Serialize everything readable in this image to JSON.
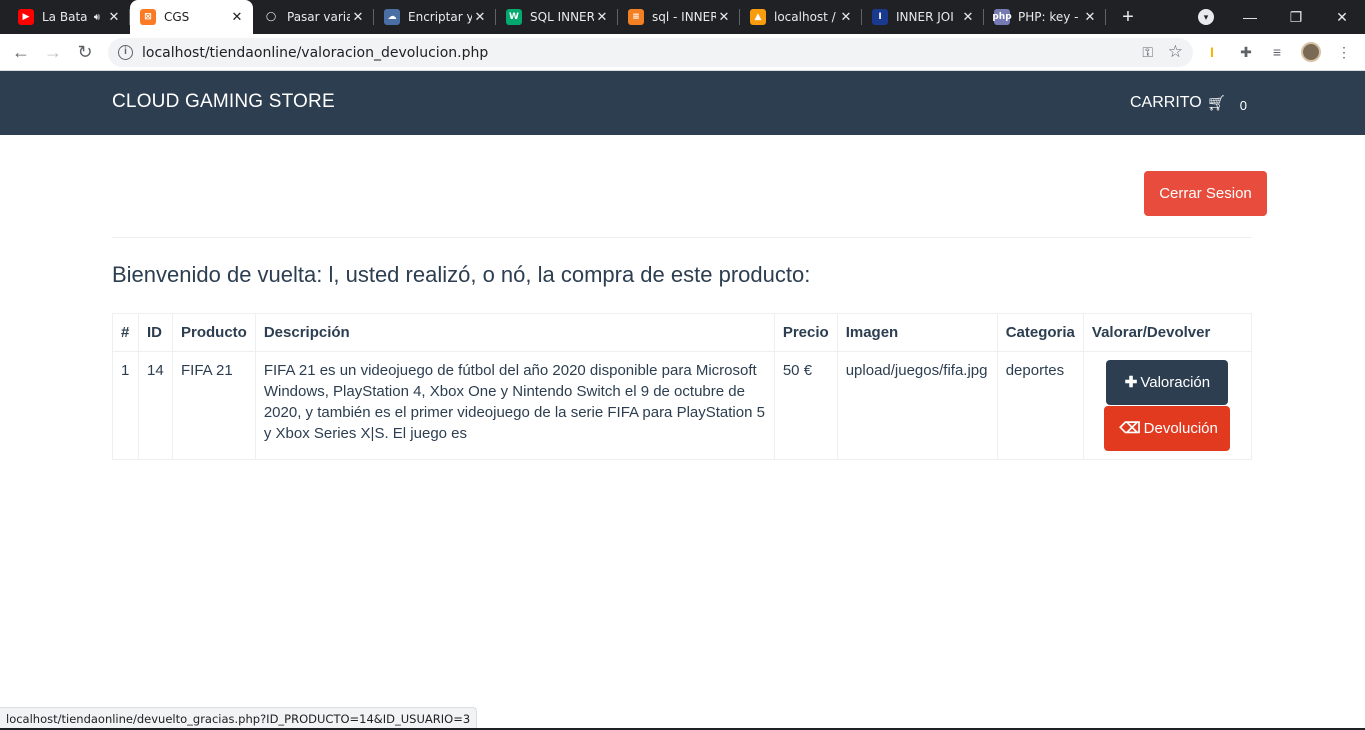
{
  "browser": {
    "tabs": [
      {
        "title": "La Bata",
        "favicon": "youtube-icon",
        "color": "#ff0000",
        "glyph": "▶",
        "audio": true,
        "active": false
      },
      {
        "title": "CGS",
        "favicon": "xampp-icon",
        "color": "#fb7a24",
        "glyph": "⊠",
        "active": true
      },
      {
        "title": "Pasar varia",
        "favicon": "circle-icon",
        "color": "#202124",
        "glyph": "◯",
        "active": false
      },
      {
        "title": "Encriptar y",
        "favicon": "cloud-icon",
        "color": "#4a6fa5",
        "glyph": "☁",
        "active": false
      },
      {
        "title": "SQL INNER",
        "favicon": "w3schools-icon",
        "color": "#04aa6d",
        "glyph": "W",
        "active": false
      },
      {
        "title": "sql - INNER",
        "favicon": "stackoverflow-icon",
        "color": "#f48024",
        "glyph": "≡",
        "active": false
      },
      {
        "title": "localhost /",
        "favicon": "phpmyadmin-icon",
        "color": "#f89c0e",
        "glyph": "▲",
        "active": false
      },
      {
        "title": "INNER JOI",
        "favicon": "doc-icon",
        "color": "#1a3a8f",
        "glyph": "I",
        "active": false
      },
      {
        "title": "PHP: key -",
        "favicon": "php-icon",
        "color": "#777bb3",
        "glyph": "php",
        "active": false
      }
    ],
    "url": "localhost/tiendaonline/valoracion_devolucion.php",
    "status_url": "localhost/tiendaonline/devuelto_gracias.php?ID_PRODUCTO=14&ID_USUARIO=3"
  },
  "site": {
    "brand": "CLOUD GAMING STORE",
    "cart_label": "CARRITO",
    "cart_count": "0",
    "logout_label": "Cerrar Sesion",
    "welcome": "Bienvenido de vuelta: l, usted realizó, o nó, la compra de este producto:",
    "colors": {
      "navbar": "#2c3e50",
      "logout": "#e74c3c",
      "valorar": "#2c3e50",
      "devolver": "#e23a1f"
    }
  },
  "table": {
    "headers": [
      "#",
      "ID",
      "Producto",
      "Descripción",
      "Precio",
      "Imagen",
      "Categoria",
      "Valorar/Devolver"
    ],
    "rows": [
      {
        "num": "1",
        "id": "14",
        "producto": "FIFA 21",
        "descripcion": "FIFA 21 es un videojuego de fútbol del año 2020 disponible para Microsoft Windows, PlayStation 4, Xbox One y Nintendo Switch el 9 de octubre de 2020, y también es el primer videojuego de la serie FIFA para PlayStation 5 y Xbox Series X|S. El juego es",
        "precio": "50 €",
        "imagen": "upload/juegos/fifa.jpg",
        "categoria": "deportes",
        "valorar_label": "Valoración",
        "devolver_label": "Devolución"
      }
    ]
  }
}
